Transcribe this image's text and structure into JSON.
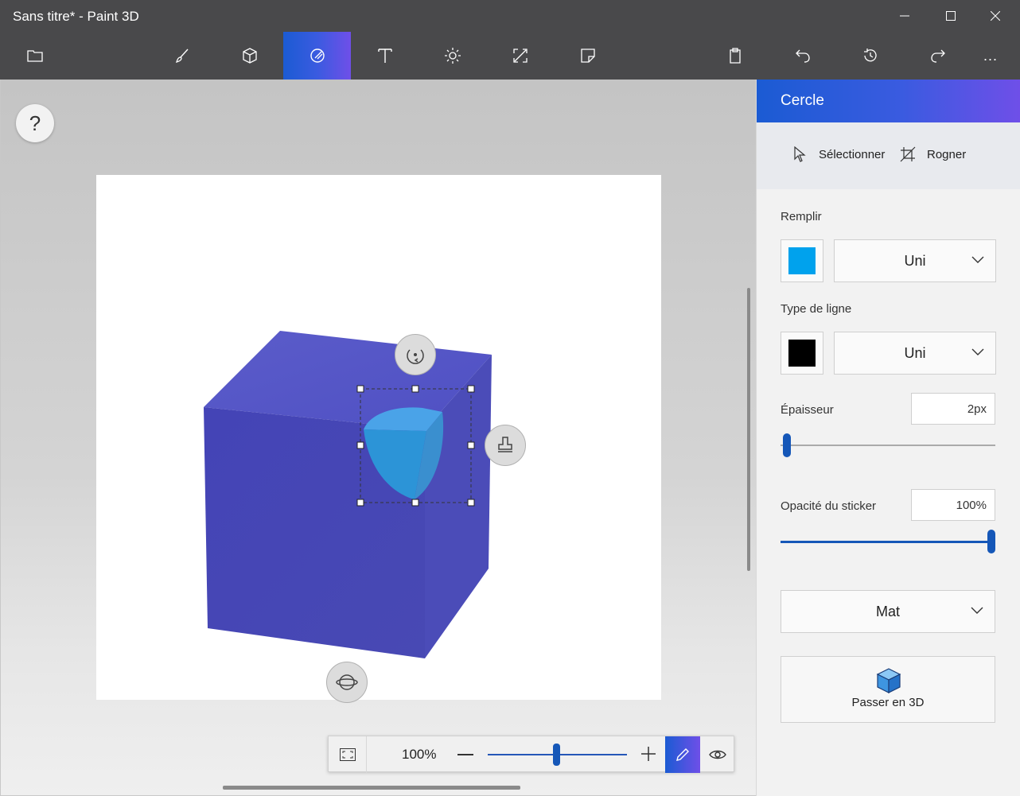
{
  "window": {
    "title": "Sans titre* - Paint 3D",
    "controls": [
      "minimize-icon",
      "maximize-icon",
      "close-icon"
    ]
  },
  "toolbar": {
    "left": [
      {
        "name": "menu",
        "icon": "folder-icon"
      }
    ],
    "tools": [
      {
        "name": "brushes",
        "icon": "brush-icon"
      },
      {
        "name": "3d-shapes",
        "icon": "cube-icon"
      },
      {
        "name": "2d-shapes",
        "icon": "shapes-icon",
        "active": true
      },
      {
        "name": "text",
        "icon": "text-icon"
      },
      {
        "name": "effects",
        "icon": "sun-icon"
      },
      {
        "name": "canvas",
        "icon": "resize-icon"
      },
      {
        "name": "stickers",
        "icon": "sticker-icon"
      }
    ],
    "right": [
      {
        "name": "paste",
        "icon": "clipboard-icon"
      },
      {
        "name": "undo",
        "icon": "undo-icon"
      },
      {
        "name": "history",
        "icon": "history-icon"
      },
      {
        "name": "redo",
        "icon": "redo-icon"
      },
      {
        "name": "more",
        "icon": "more-icon",
        "label": "..."
      }
    ],
    "accent": "#3a5be0"
  },
  "workspace": {
    "help_label": "?",
    "zoom": {
      "value": "100%",
      "level": 0.5
    },
    "floating": [
      "rotate-icon",
      "stamp-icon",
      "orbit-icon"
    ],
    "cube_color": "#4a4cbf",
    "shape_color": "#2a93d8"
  },
  "panel": {
    "title": "Cercle",
    "select_label": "Sélectionner",
    "crop_label": "Rogner",
    "fill": {
      "label": "Remplir",
      "color": "#00a2ed",
      "type": "Uni"
    },
    "line": {
      "label": "Type de ligne",
      "color": "#000000",
      "type": "Uni"
    },
    "thickness": {
      "label": "Épaisseur",
      "value": "2px",
      "level": 0.03
    },
    "opacity": {
      "label": "Opacité du sticker",
      "value": "100%",
      "level": 1.0
    },
    "finish": "Mat",
    "make3d_label": "Passer en 3D"
  }
}
